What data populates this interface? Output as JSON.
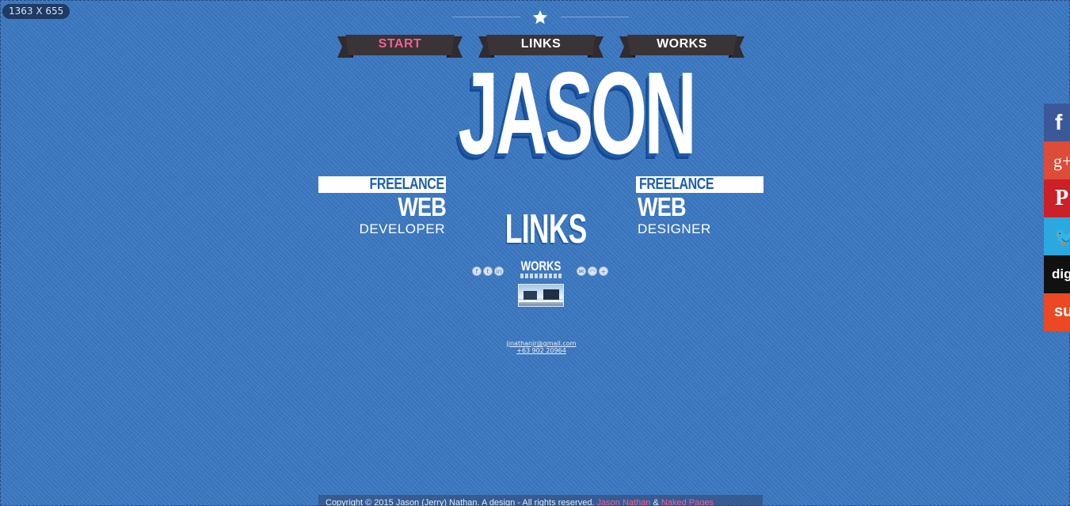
{
  "overlay": {
    "dimensions": "1363 X 655"
  },
  "nav": {
    "items": [
      {
        "label": "START",
        "active": true
      },
      {
        "label": "LINKS",
        "active": false
      },
      {
        "label": "WORKS",
        "active": false
      }
    ]
  },
  "hero": {
    "name": "JASON",
    "left_tag": {
      "line1": "FREELANCE",
      "line2": "WEB",
      "line3": "DEVELOPER"
    },
    "right_tag": {
      "line1": "FREELANCE",
      "line2": "WEB",
      "line3": "DESIGNER"
    }
  },
  "links_section": {
    "title": "LINKS",
    "left_icons": [
      "facebook-icon",
      "twitter-icon",
      "linkedin-icon"
    ],
    "right_icons": [
      "email-icon",
      "rss-icon",
      "share-icon"
    ]
  },
  "works_section": {
    "title": "WORKS"
  },
  "contact": {
    "email": "jjnathanjr@gmail.com",
    "phone": "+63 902 20964"
  },
  "footer": {
    "text": "Copyright © 2015 Jason (Jerry) Nathan. A design - All rights reserved. ",
    "link1": "Jason Nathan",
    "sep": " & ",
    "link2": "Naked Pages"
  },
  "share_bar": [
    {
      "icon": "facebook-icon",
      "glyph": "f",
      "color": "#3b5998"
    },
    {
      "icon": "google-plus-icon",
      "glyph": "g+",
      "color": "#dd4b39"
    },
    {
      "icon": "pinterest-icon",
      "glyph": "P",
      "color": "#cb2027"
    },
    {
      "icon": "twitter-icon",
      "glyph": "t",
      "color": "#2ca8e0"
    },
    {
      "icon": "digg-icon",
      "glyph": "digg",
      "color": "#111111"
    },
    {
      "icon": "stumbleupon-icon",
      "glyph": "su",
      "color": "#eb4924"
    }
  ]
}
